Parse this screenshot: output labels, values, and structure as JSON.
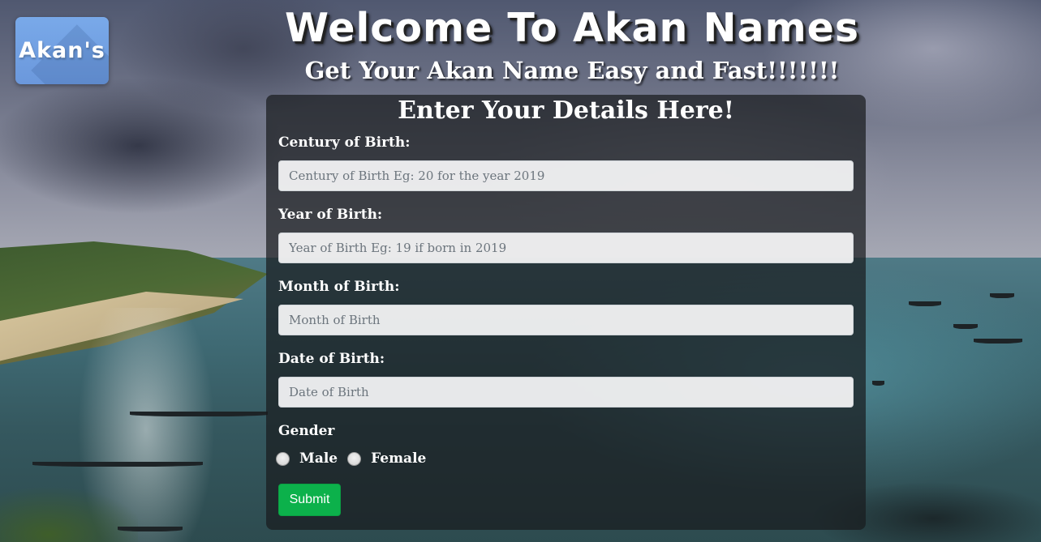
{
  "logo": {
    "text": "Akan's"
  },
  "header": {
    "title": "Welcome To Akan Names",
    "subtitle": "Get Your Akan Name Easy and Fast!!!!!!!"
  },
  "form": {
    "heading": "Enter Your Details Here!",
    "century": {
      "label": "Century of Birth:",
      "placeholder": "Century of Birth Eg: 20 for the year 2019",
      "value": ""
    },
    "year": {
      "label": "Year of Birth:",
      "placeholder": "Year of Birth Eg: 19 if born in 2019",
      "value": ""
    },
    "month": {
      "label": "Month of Birth:",
      "placeholder": "Month of Birth",
      "value": ""
    },
    "date": {
      "label": "Date of Birth:",
      "placeholder": "Date of Birth",
      "value": ""
    },
    "gender": {
      "label": "Gender",
      "options": [
        "Male",
        "Female"
      ],
      "selected": null
    },
    "submit_label": "Submit"
  },
  "colors": {
    "submit": "#0cb14b",
    "logo": "#79a9e9",
    "panel": "rgba(25,28,30,0.72)"
  }
}
